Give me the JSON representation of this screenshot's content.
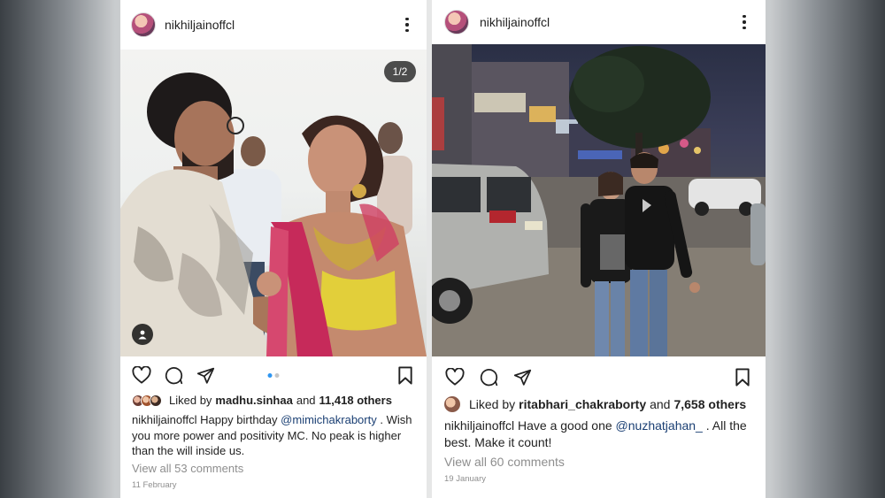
{
  "posts": [
    {
      "username": "nikhiljainoffcl",
      "image_counter": "1/2",
      "liked_by_prefix": "Liked by",
      "liked_by_user": "madhu.sinhaa",
      "liked_by_mid": "and",
      "liked_by_others": "11,418 others",
      "caption_user": "nikhiljainoffcl",
      "caption_pre": "Happy birthday",
      "caption_mention": "@mimichakraborty",
      "caption_post": ". Wish you more power and positivity MC. No peak is higher than the will inside us.",
      "view_comments": "View all 53 comments",
      "date": "11 February"
    },
    {
      "username": "nikhiljainoffcl",
      "liked_by_prefix": "Liked by",
      "liked_by_user": "ritabhari_chakraborty",
      "liked_by_mid": "and",
      "liked_by_others": "7,658 others",
      "caption_user": "nikhiljainoffcl",
      "caption_pre": "Have a good one",
      "caption_mention": "@nuzhatjahan_",
      "caption_post": ". All the best. Make it count!",
      "view_comments": "View all 60 comments",
      "date": "19 January"
    }
  ],
  "icons": {
    "more": "more-options-icon",
    "like": "heart-icon",
    "comment": "comment-icon",
    "share": "send-icon",
    "save": "bookmark-icon",
    "tag": "user-tag-icon"
  },
  "colors": {
    "mention": "#1a3f73",
    "muted": "#8e8e8e",
    "carousel_active": "#2f96f1"
  }
}
